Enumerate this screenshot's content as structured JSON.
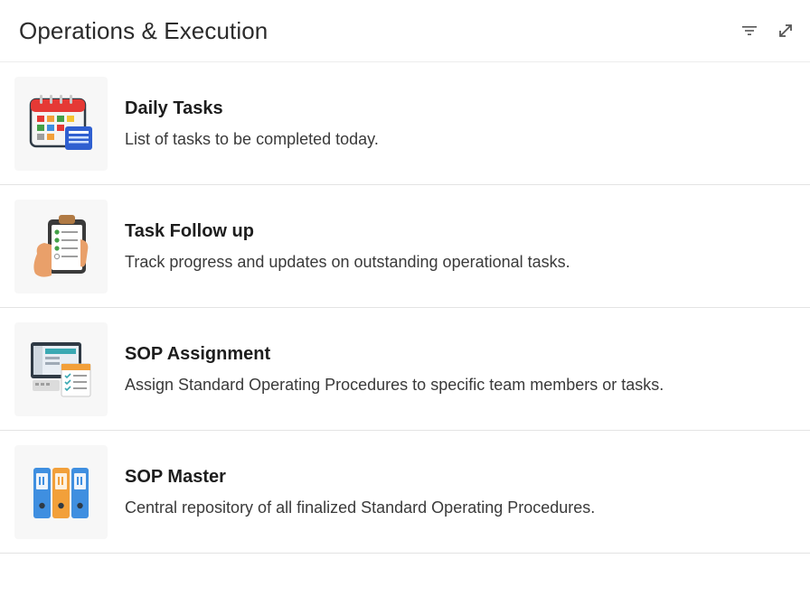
{
  "header": {
    "title": "Operations & Execution",
    "actions": [
      {
        "icon": "filter-icon"
      },
      {
        "icon": "expand-icon"
      }
    ]
  },
  "items": [
    {
      "icon": "calendar-icon",
      "title": "Daily Tasks",
      "description": "List of tasks to be completed today."
    },
    {
      "icon": "clipboard-checklist-icon",
      "title": "Task Follow up",
      "description": "Track progress and updates on outstanding operational tasks."
    },
    {
      "icon": "sop-assignment-icon",
      "title": "SOP Assignment",
      "description": "Assign Standard Operating Procedures to specific team members or tasks."
    },
    {
      "icon": "binders-icon",
      "title": "SOP Master",
      "description": "Central repository of all finalized Standard Operating Procedures."
    }
  ],
  "colors": {
    "border": "#e3e3e3",
    "thumb_bg": "#f7f7f7",
    "calendar_red": "#e53935",
    "binder_blue": "#3f8fe0",
    "binder_orange": "#f2a03a"
  }
}
